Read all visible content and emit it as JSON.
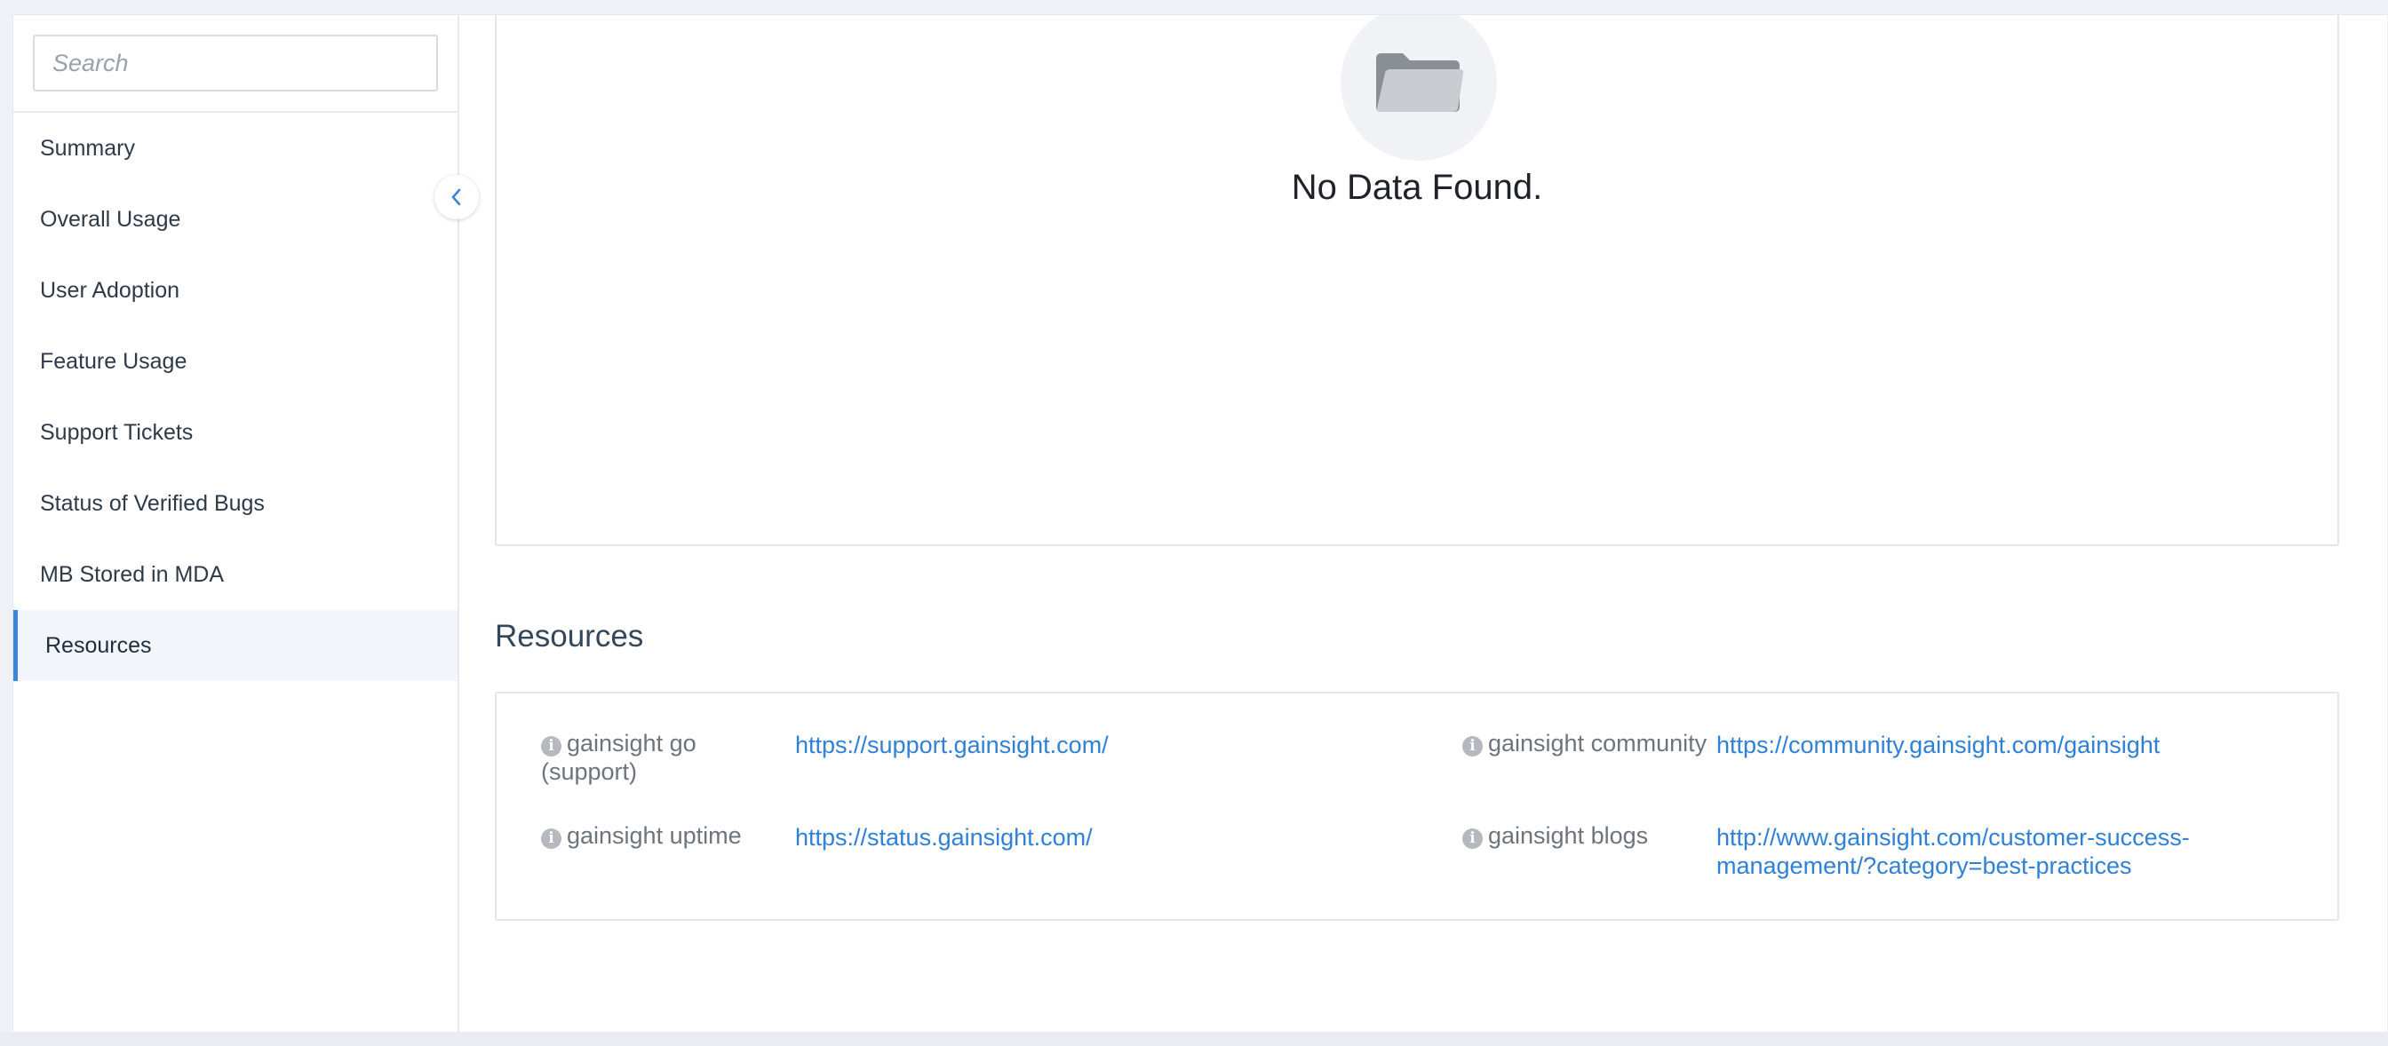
{
  "search": {
    "placeholder": "Search"
  },
  "sidebar": {
    "items": [
      {
        "label": "Summary"
      },
      {
        "label": "Overall Usage"
      },
      {
        "label": "User Adoption"
      },
      {
        "label": "Feature Usage"
      },
      {
        "label": "Support Tickets"
      },
      {
        "label": "Status of Verified Bugs"
      },
      {
        "label": "MB Stored in MDA"
      },
      {
        "label": "Resources",
        "active": true
      }
    ]
  },
  "empty_state": {
    "message": "No Data Found.",
    "icon": "folder-icon"
  },
  "resources": {
    "title": "Resources",
    "items": [
      {
        "label": "gainsight go (support)",
        "url": "https://support.gainsight.com/"
      },
      {
        "label": "gainsight community",
        "url": "https://community.gainsight.com/gainsight"
      },
      {
        "label": "gainsight uptime",
        "url": "https://status.gainsight.com/"
      },
      {
        "label": "gainsight blogs",
        "url": "http://www.gainsight.com/customer-success-management/?category=best-practices"
      }
    ]
  },
  "colors": {
    "accent": "#3a87d9",
    "link": "#2f80d6"
  }
}
